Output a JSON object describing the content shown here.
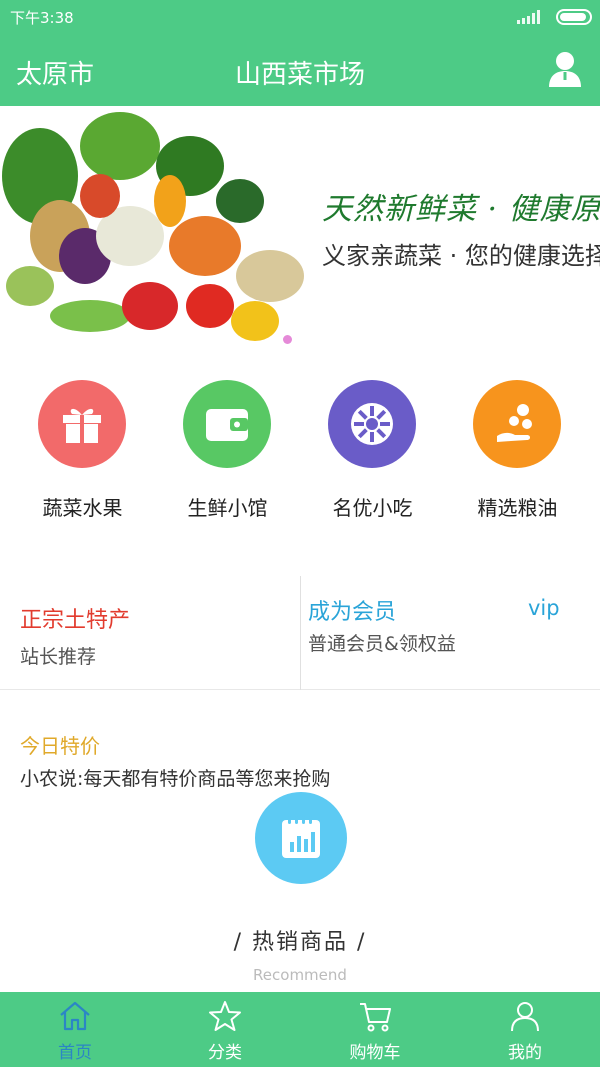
{
  "status_bar": {
    "time": "下午3:38"
  },
  "header": {
    "city": "太原市",
    "title": "山西菜市场"
  },
  "banner": {
    "slogan_main": "天然新鲜菜 · 健康原生态",
    "slogan_sub": "义家亲蔬菜 · 您的健康选择"
  },
  "categories": [
    {
      "label": "蔬菜水果",
      "color": "#f26a6a",
      "icon": "gift-box-icon"
    },
    {
      "label": "生鲜小馆",
      "color": "#58c864",
      "icon": "wallet-icon"
    },
    {
      "label": "名优小吃",
      "color": "#6a5cc8",
      "icon": "wheel-icon"
    },
    {
      "label": "精选粮油",
      "color": "#f7941d",
      "icon": "hand-coins-icon"
    }
  ],
  "promo": {
    "left_title": "正宗土特产",
    "left_sub": "站长推荐",
    "right_title": "成为会员",
    "right_badge": "vip",
    "right_sub": "普通会员&领权益"
  },
  "deal": {
    "title": "今日特价",
    "subtitle": "小农说:每天都有特价商品等您来抢购"
  },
  "hot": {
    "title": "/  热销商品  /",
    "subtitle": "Recommend"
  },
  "tabs": [
    {
      "label": "首页",
      "icon": "home-icon",
      "active": true
    },
    {
      "label": "分类",
      "icon": "star-icon",
      "active": false
    },
    {
      "label": "购物车",
      "icon": "cart-icon",
      "active": false
    },
    {
      "label": "我的",
      "icon": "user-icon",
      "active": false
    }
  ],
  "colors": {
    "brand_green": "#4dcb86",
    "active_tab": "#2b86c5",
    "special_red": "#e23b2e",
    "member_blue": "#2aa4d8",
    "deal_gold": "#e0a92a"
  }
}
